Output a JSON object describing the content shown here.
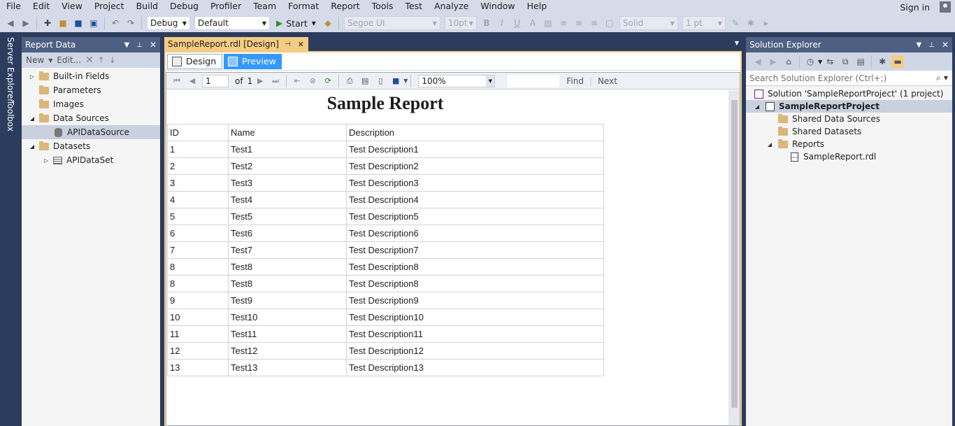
{
  "menu": [
    "File",
    "Edit",
    "View",
    "Project",
    "Build",
    "Debug",
    "Profiler",
    "Team",
    "Format",
    "Report",
    "Tools",
    "Test",
    "Analyze",
    "Window",
    "Help"
  ],
  "signin": "Sign in",
  "toolbar": {
    "config": "Debug",
    "platform": "Default",
    "start": "Start",
    "font": "Segoe UI",
    "size": "10pt",
    "border_style": "Solid",
    "border_width": "1 pt"
  },
  "side_tabs": [
    "Server Explorer",
    "Toolbox"
  ],
  "report_data": {
    "title": "Report Data",
    "tools": [
      "New",
      "Edit..."
    ],
    "tree": [
      {
        "label": "Built-in Fields",
        "level": 0,
        "exp": "right",
        "icon": "folder"
      },
      {
        "label": "Parameters",
        "level": 0,
        "exp": "",
        "icon": "folder"
      },
      {
        "label": "Images",
        "level": 0,
        "exp": "",
        "icon": "folder"
      },
      {
        "label": "Data Sources",
        "level": 0,
        "exp": "down",
        "icon": "folder"
      },
      {
        "label": "APIDataSource",
        "level": 1,
        "exp": "",
        "icon": "database",
        "selected": true
      },
      {
        "label": "Datasets",
        "level": 0,
        "exp": "down",
        "icon": "folder"
      },
      {
        "label": "APIDataSet",
        "level": 1,
        "exp": "right",
        "icon": "dataset"
      }
    ]
  },
  "document": {
    "tab": "SampleReport.rdl [Design]",
    "subtabs": {
      "design": "Design",
      "preview": "Preview"
    },
    "viewer": {
      "page": "1",
      "of": "of",
      "total": "1",
      "zoom": "100%",
      "find": "Find",
      "next": "Next"
    },
    "report": {
      "title": "Sample Report",
      "headers": [
        "ID",
        "Name",
        "Description"
      ],
      "rows": [
        [
          "1",
          "Test1",
          "Test Description1"
        ],
        [
          "2",
          "Test2",
          "Test Description2"
        ],
        [
          "3",
          "Test3",
          "Test Description3"
        ],
        [
          "4",
          "Test4",
          "Test Description4"
        ],
        [
          "5",
          "Test5",
          "Test Description5"
        ],
        [
          "6",
          "Test6",
          "Test Description6"
        ],
        [
          "7",
          "Test7",
          "Test Description7"
        ],
        [
          "8",
          "Test8",
          "Test Description8"
        ],
        [
          "8",
          "Test8",
          "Test Description8"
        ],
        [
          "9",
          "Test9",
          "Test Description9"
        ],
        [
          "10",
          "Test10",
          "Test Description10"
        ],
        [
          "11",
          "Test11",
          "Test Description11"
        ],
        [
          "12",
          "Test12",
          "Test Description12"
        ],
        [
          "13",
          "Test13",
          "Test Description13"
        ]
      ]
    }
  },
  "solution_explorer": {
    "title": "Solution Explorer",
    "search_placeholder": "Search Solution Explorer (Ctrl+;)",
    "tree": [
      {
        "label": "Solution 'SampleReportProject' (1 project)",
        "level": 0,
        "exp": "",
        "icon": "solution"
      },
      {
        "label": "SampleReportProject",
        "level": 0,
        "exp": "down",
        "icon": "project",
        "selected": true
      },
      {
        "label": "Shared Data Sources",
        "level": 1,
        "exp": "",
        "icon": "folder"
      },
      {
        "label": "Shared Datasets",
        "level": 1,
        "exp": "",
        "icon": "folder"
      },
      {
        "label": "Reports",
        "level": 1,
        "exp": "down",
        "icon": "folder"
      },
      {
        "label": "SampleReport.rdl",
        "level": 2,
        "exp": "",
        "icon": "rdl"
      }
    ]
  }
}
